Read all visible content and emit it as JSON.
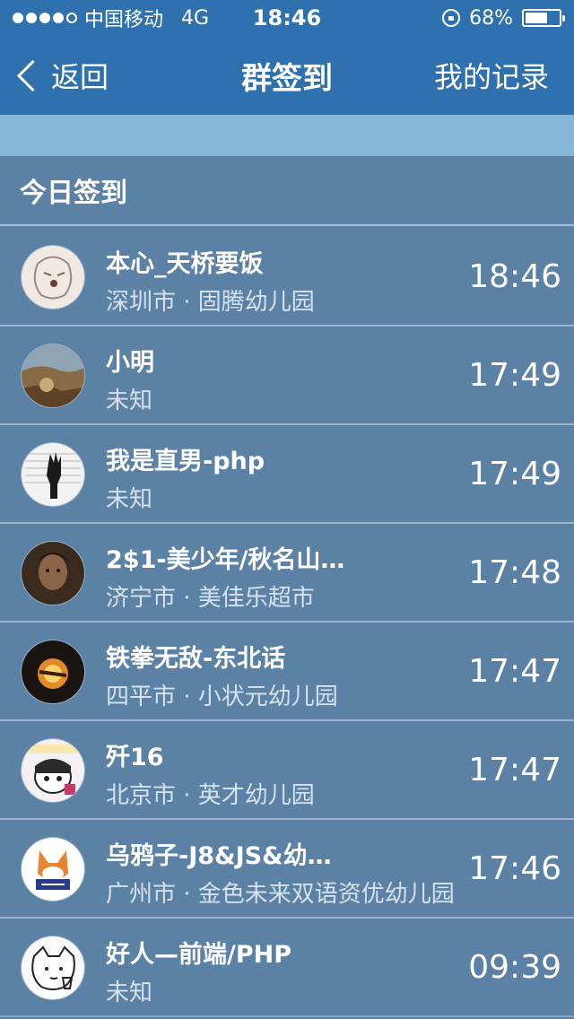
{
  "status_bar": {
    "carrier": "中国移动",
    "network": "4G",
    "time": "18:46",
    "battery": "68%",
    "battery_level": 0.68,
    "signal_bars_filled": 4,
    "signal_bars_total": 5
  },
  "nav": {
    "back_label": "返回",
    "title": "群签到",
    "right_label": "我的记录"
  },
  "section": {
    "title": "今日签到"
  },
  "checkins": [
    {
      "name": "本心_天桥要饭",
      "location": "深圳市 · 固腾幼儿园",
      "time": "18:46"
    },
    {
      "name": "小明",
      "location": "未知",
      "time": "17:49"
    },
    {
      "name": "我是直男-php",
      "location": "未知",
      "time": "17:49"
    },
    {
      "name": "2$1-美少年/秋名山…",
      "location": "济宁市 · 美佳乐超市",
      "time": "17:48"
    },
    {
      "name": "铁拳无敌-东北话",
      "location": "四平市 · 小状元幼儿园",
      "time": "17:47"
    },
    {
      "name": "歼16",
      "location": "北京市 · 英才幼儿园",
      "time": "17:47"
    },
    {
      "name": "乌鸦子-J8&JS&幼…",
      "location": "广州市 · 金色未来双语资优幼儿园",
      "time": "17:46"
    },
    {
      "name": "好人—前端/PHP",
      "location": "未知",
      "time": "09:39"
    }
  ],
  "colors": {
    "nav_bg": "#2f70ae",
    "band": "#86b6d8",
    "list_bg": "#5b81a5"
  }
}
